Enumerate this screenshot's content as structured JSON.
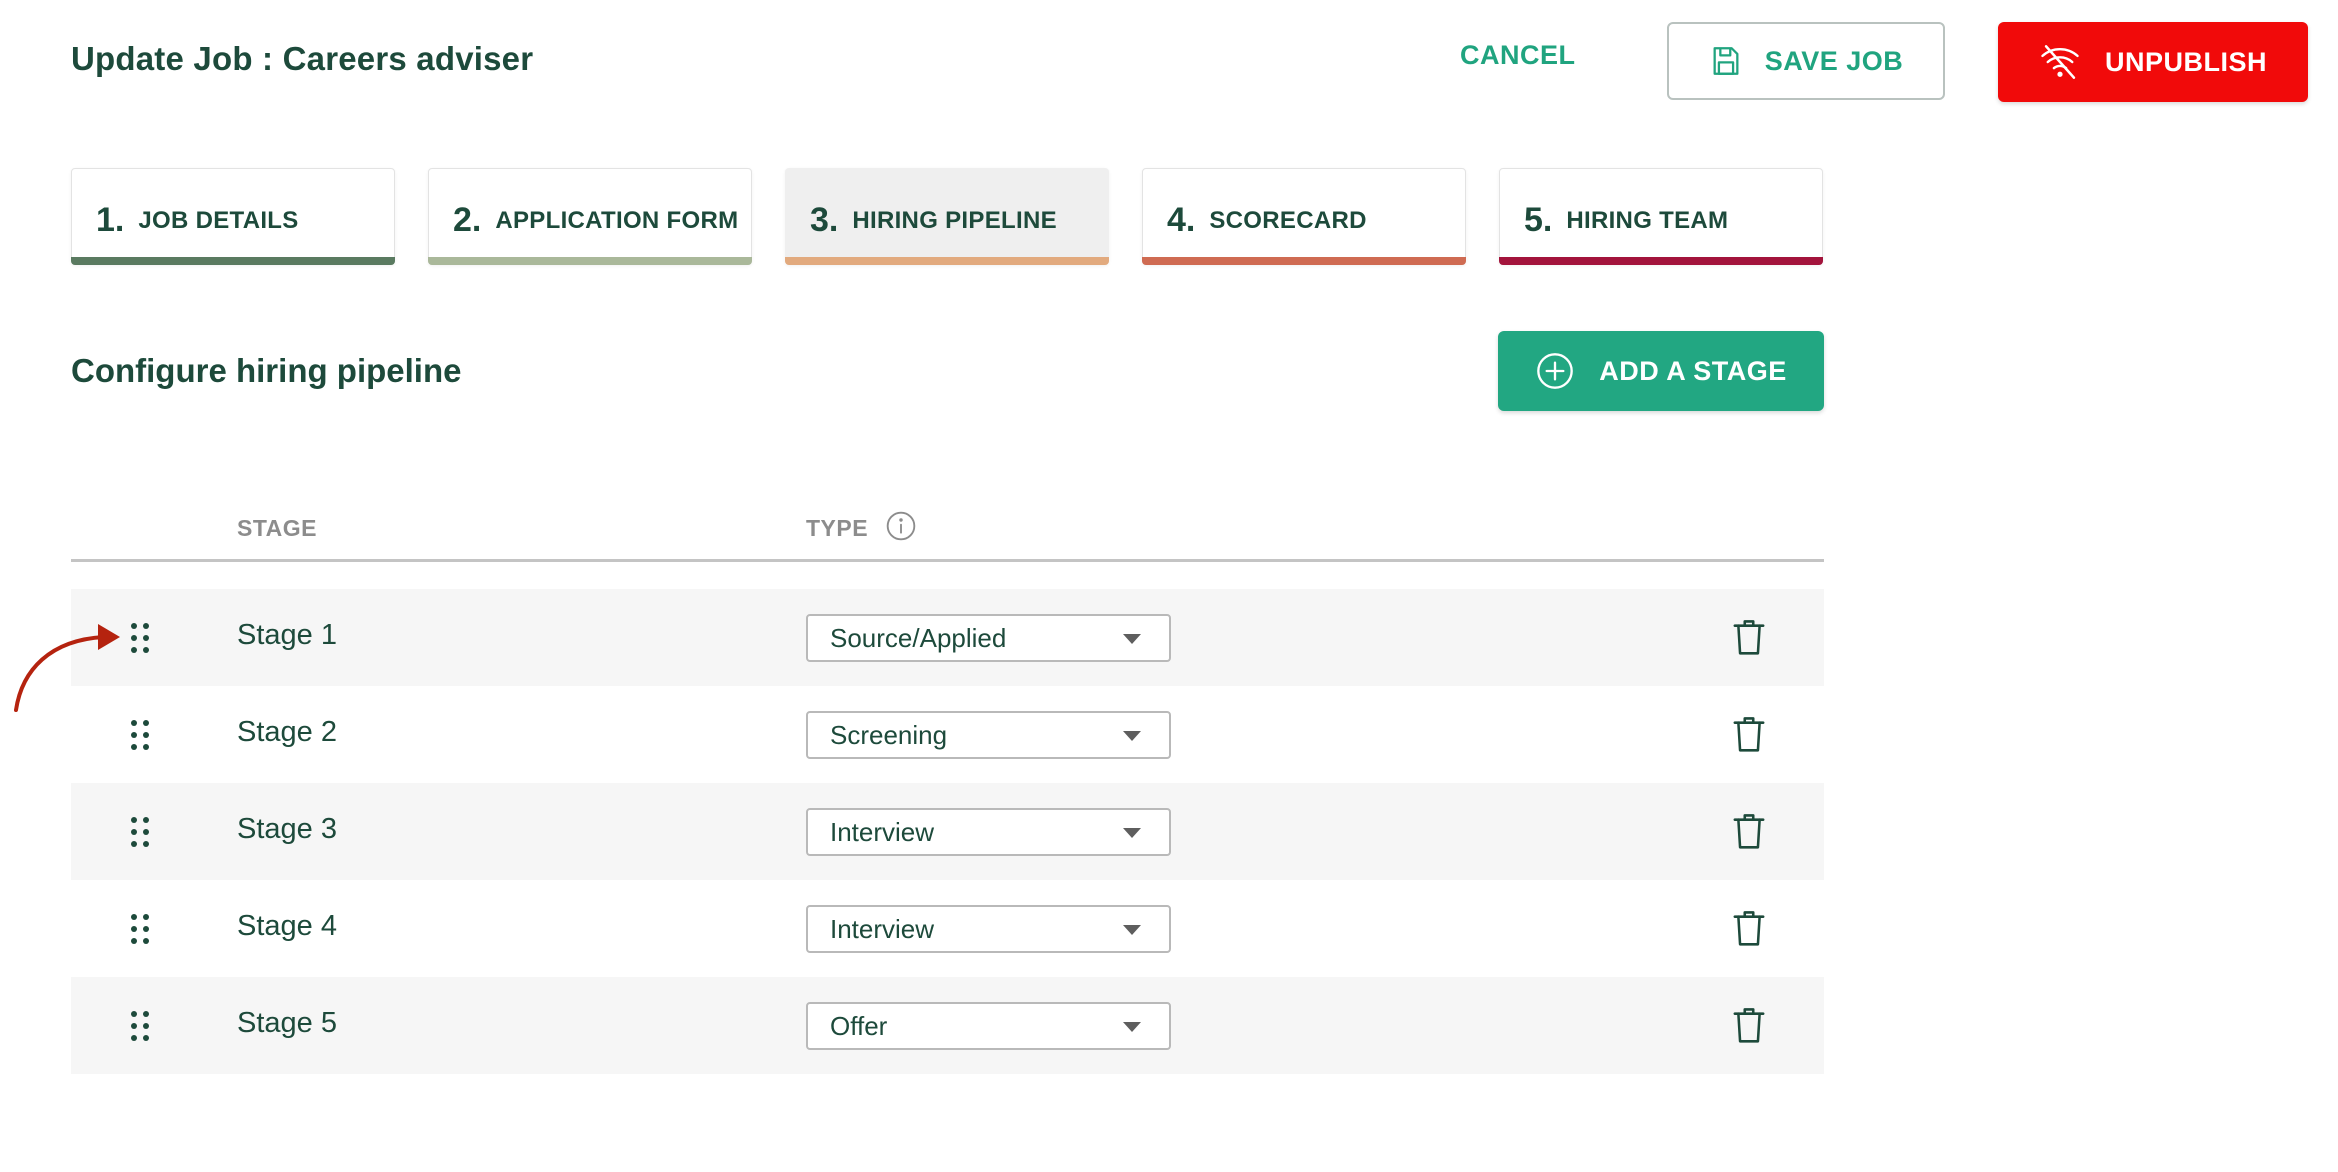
{
  "header": {
    "title": "Update Job : Careers adviser",
    "cancel_label": "CANCEL",
    "save_label": "SAVE JOB",
    "unpublish_label": "UNPUBLISH"
  },
  "tabs": [
    {
      "num": "1.",
      "label": "JOB DETAILS",
      "color": "#5a7a60"
    },
    {
      "num": "2.",
      "label": "APPLICATION FORM",
      "color": "#aab89a"
    },
    {
      "num": "3.",
      "label": "HIRING PIPELINE",
      "color": "#e2aa7e",
      "active": true
    },
    {
      "num": "4.",
      "label": "SCORECARD",
      "color": "#cf6b52"
    },
    {
      "num": "5.",
      "label": "HIRING TEAM",
      "color": "#a3143c"
    }
  ],
  "section": {
    "title": "Configure hiring pipeline",
    "add_stage_label": "ADD A STAGE"
  },
  "table": {
    "headers": {
      "stage": "STAGE",
      "type": "TYPE"
    },
    "rows": [
      {
        "stage": "Stage 1",
        "type": "Source/Applied"
      },
      {
        "stage": "Stage 2",
        "type": "Screening"
      },
      {
        "stage": "Stage 3",
        "type": "Interview"
      },
      {
        "stage": "Stage 4",
        "type": "Interview"
      },
      {
        "stage": "Stage 5",
        "type": "Offer"
      }
    ]
  },
  "icons": {
    "save": "floppy-disk-icon",
    "unpublish": "no-signal-icon",
    "add": "plus-circle-icon",
    "info": "info-icon",
    "drag": "drag-handle-icon",
    "delete": "trash-icon",
    "annotation": "curved-arrow-icon"
  },
  "colors": {
    "brand_dark": "#1d4a3b",
    "accent_green": "#20a47f",
    "danger_red": "#f10a0a",
    "annotation_arrow": "#b5230f"
  }
}
